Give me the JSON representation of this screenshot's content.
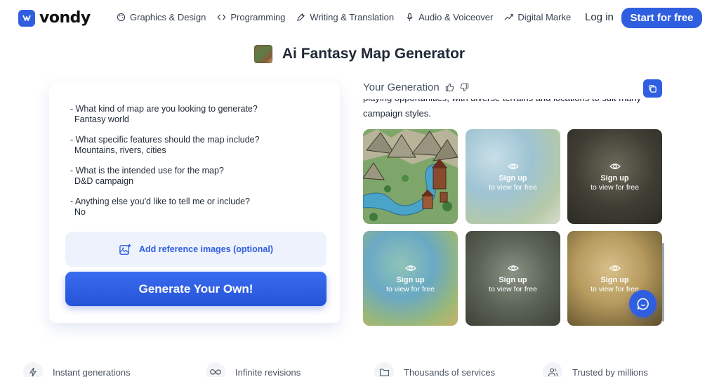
{
  "header": {
    "logo_text": "vondy",
    "nav": [
      {
        "label": "Graphics & Design",
        "icon": "palette-icon"
      },
      {
        "label": "Programming",
        "icon": "code-icon"
      },
      {
        "label": "Writing & Translation",
        "icon": "pen-icon"
      },
      {
        "label": "Audio & Voiceover",
        "icon": "microphone-icon"
      },
      {
        "label": "Digital Marke",
        "icon": "trend-icon"
      }
    ],
    "login": "Log in",
    "start": "Start for free"
  },
  "page": {
    "title": "Ai Fantasy Map Generator"
  },
  "form": {
    "qa": [
      {
        "q": "- What kind of map are you looking to generate?",
        "a": "Fantasy world"
      },
      {
        "q": "- What specific features should the map include?",
        "a": "Mountains, rivers, cities"
      },
      {
        "q": "- What is the intended use for the map?",
        "a": "D&D campaign"
      },
      {
        "q": "- Anything else you'd like to tell me or include?",
        "a": "No"
      }
    ],
    "reference_label": "Add reference images (optional)",
    "generate_label": "Generate Your Own!"
  },
  "generation": {
    "heading": "Your Generation",
    "description": "playing opportunities, with diverse terrains and locations to suit many campaign styles.",
    "tiles": [
      {
        "signup": "",
        "view": ""
      },
      {
        "signup": "Sign up",
        "view": "to view for free"
      },
      {
        "signup": "Sign up",
        "view": "to view for free"
      },
      {
        "signup": "Sign up",
        "view": "to view for free"
      },
      {
        "signup": "Sign up",
        "view": "to view for free"
      },
      {
        "signup": "Sign up",
        "view": "to view for free"
      }
    ]
  },
  "features": [
    {
      "label": "Instant generations",
      "icon": "lightning-icon"
    },
    {
      "label": "Infinite revisions",
      "icon": "infinity-icon"
    },
    {
      "label": "Thousands of services",
      "icon": "folders-icon"
    },
    {
      "label": "Trusted by millions",
      "icon": "users-icon"
    }
  ],
  "colors": {
    "accent": "#2f5fe0",
    "reference_bg": "#eef2fc"
  }
}
